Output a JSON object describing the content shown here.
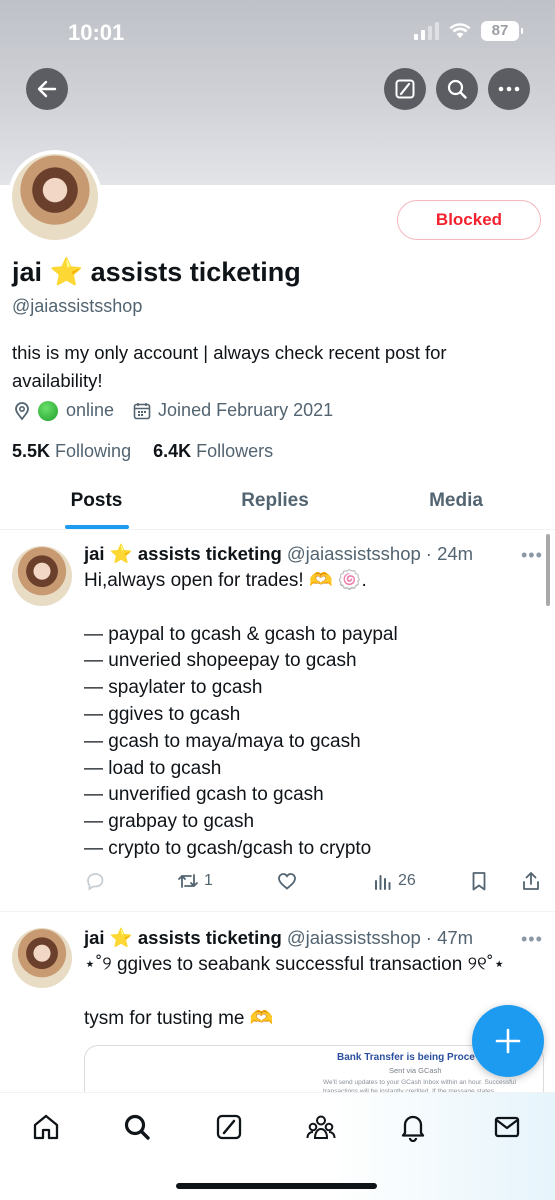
{
  "status_bar": {
    "time": "10:01",
    "battery": "87"
  },
  "top_bar": {
    "back_icon": "back-arrow-icon",
    "grok_icon": "grok-icon",
    "search_icon": "search-icon",
    "more_icon": "more-icon"
  },
  "profile": {
    "blocked_label": "Blocked",
    "display_name": "jai ⭐ assists ticketing",
    "handle": "@jaiassistsshop",
    "bio": "this is my only account | always check recent post for availability!",
    "location": "online",
    "joined": "Joined February 2021",
    "following_count": "5.5K",
    "following_label": "Following",
    "followers_count": "6.4K",
    "followers_label": "Followers"
  },
  "tabs": [
    {
      "label": "Posts",
      "active": true
    },
    {
      "label": "Replies",
      "active": false
    },
    {
      "label": "Media",
      "active": false
    }
  ],
  "tweets": [
    {
      "name": "jai ⭐ assists ticketing",
      "handle": "@jaiassistsshop",
      "time": "· 24m",
      "lines": [
        "Hi,always open for trades! 🫶 🍥.",
        "",
        "— paypal to gcash & gcash to paypal",
        "— unveried shopeepay to gcash",
        "— spaylater to gcash",
        "— ggives to gcash",
        "— gcash to maya/maya to gcash",
        "— load to gcash",
        "— unverified gcash to gcash",
        "— grabpay to gcash",
        "— crypto to gcash/gcash to crypto"
      ],
      "retweets": "1",
      "views": "26"
    },
    {
      "name": "jai ⭐ assists ticketing",
      "handle": "@jaiassistsshop",
      "time": "· 47m",
      "lines": [
        "⋆˚୨ ggives to seabank successful transaction ୨୧˚⋆",
        "",
        "tysm for tusting me 🫶"
      ],
      "embed": {
        "title": "Bank Transfer is being Proce",
        "subtitle": "Sent via GCash",
        "line1": "We'll send updates to your GCash Inbox within an hour. Successful",
        "line2": "transactions will be instantly credited. If the message states"
      }
    }
  ],
  "bottom_nav": [
    "home-icon",
    "search-icon",
    "grok-icon",
    "communities-icon",
    "notifications-icon",
    "messages-icon"
  ]
}
